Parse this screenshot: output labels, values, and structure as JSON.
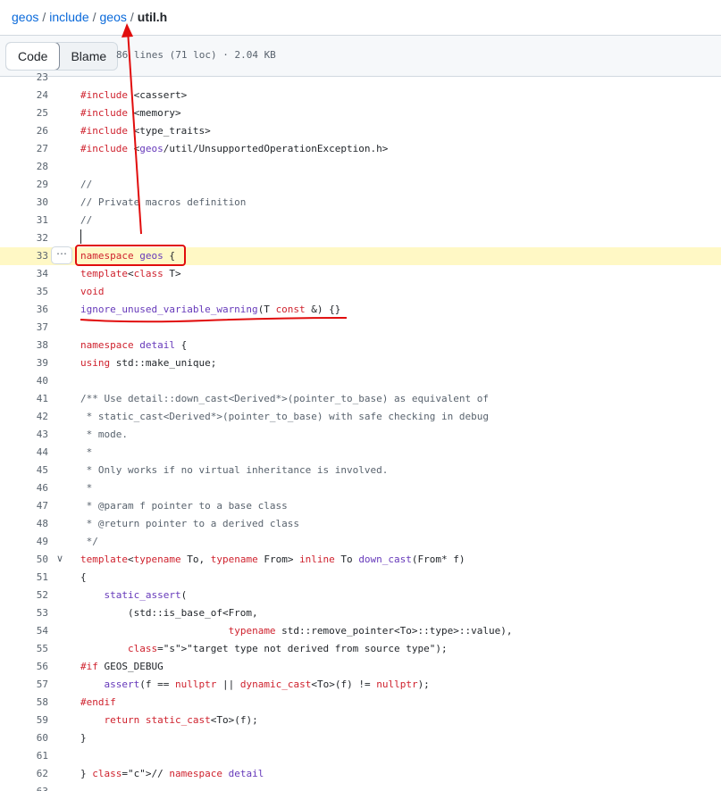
{
  "breadcrumb": {
    "repo": "geos",
    "dir1": "include",
    "dir2": "geos",
    "file": "util.h",
    "sep": "/"
  },
  "toolbar": {
    "code_label": "Code",
    "blame_label": "Blame",
    "file_info": "86 lines (71 loc) · 2.04 KB"
  },
  "code": {
    "more_icon": "⋯",
    "chevron": "∨",
    "lines": [
      {
        "n": "23",
        "t": ""
      },
      {
        "n": "24",
        "t": "#include <cassert>"
      },
      {
        "n": "25",
        "t": "#include <memory>"
      },
      {
        "n": "26",
        "t": "#include <type_traits>"
      },
      {
        "n": "27",
        "t": "#include <geos/util/UnsupportedOperationException.h>"
      },
      {
        "n": "28",
        "t": ""
      },
      {
        "n": "29",
        "t": "//"
      },
      {
        "n": "30",
        "t": "// Private macros definition"
      },
      {
        "n": "31",
        "t": "//"
      },
      {
        "n": "32",
        "t": ""
      },
      {
        "n": "33",
        "t": "namespace geos {"
      },
      {
        "n": "34",
        "t": "template<class T>"
      },
      {
        "n": "35",
        "t": "void"
      },
      {
        "n": "36",
        "t": "ignore_unused_variable_warning(T const &) {}"
      },
      {
        "n": "37",
        "t": ""
      },
      {
        "n": "38",
        "t": "namespace detail {"
      },
      {
        "n": "39",
        "t": "using std::make_unique;"
      },
      {
        "n": "40",
        "t": ""
      },
      {
        "n": "41",
        "t": "/** Use detail::down_cast<Derived*>(pointer_to_base) as equivalent of"
      },
      {
        "n": "42",
        "t": " * static_cast<Derived*>(pointer_to_base) with safe checking in debug"
      },
      {
        "n": "43",
        "t": " * mode."
      },
      {
        "n": "44",
        "t": " *"
      },
      {
        "n": "45",
        "t": " * Only works if no virtual inheritance is involved."
      },
      {
        "n": "46",
        "t": " *"
      },
      {
        "n": "47",
        "t": " * @param f pointer to a base class"
      },
      {
        "n": "48",
        "t": " * @return pointer to a derived class"
      },
      {
        "n": "49",
        "t": " */"
      },
      {
        "n": "50",
        "t": "template<typename To, typename From> inline To down_cast(From* f)"
      },
      {
        "n": "51",
        "t": "{"
      },
      {
        "n": "52",
        "t": "    static_assert("
      },
      {
        "n": "53",
        "t": "        (std::is_base_of<From,"
      },
      {
        "n": "54",
        "t": "                         typename std::remove_pointer<To>::type>::value),"
      },
      {
        "n": "55",
        "t": "        \"target type not derived from source type\");"
      },
      {
        "n": "56",
        "t": "#if GEOS_DEBUG"
      },
      {
        "n": "57",
        "t": "    assert(f == nullptr || dynamic_cast<To>(f) != nullptr);"
      },
      {
        "n": "58",
        "t": "#endif"
      },
      {
        "n": "59",
        "t": "    return static_cast<To>(f);"
      },
      {
        "n": "60",
        "t": "}"
      },
      {
        "n": "61",
        "t": ""
      },
      {
        "n": "62",
        "t": "} // namespace detail"
      },
      {
        "n": "63",
        "t": ""
      }
    ]
  },
  "annotation": {
    "color": "#e10d0d"
  }
}
